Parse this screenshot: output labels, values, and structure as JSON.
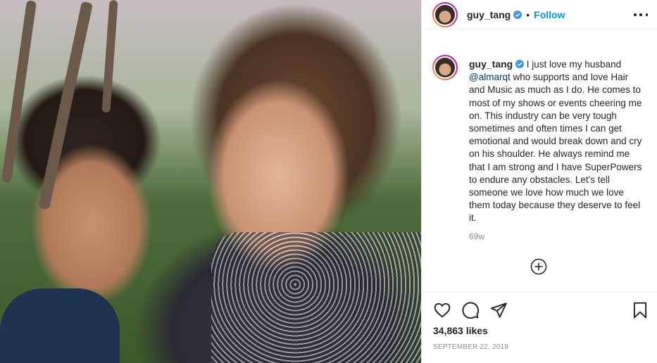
{
  "post": {
    "username": "guy_tang",
    "follow_label": "Follow",
    "separator": "•",
    "caption_mention": "@almarqt",
    "caption_before": "I just love my husband",
    "caption_after": "who supports and love Hair and Music as much as I do. He comes to most of my shows or events cheering me on. This industry can be very tough sometimes and often times I can get emotional and would break down and cry on his shoulder. He always remind me that I am strong and I have SuperPowers to endure any obstacles. Let's tell someone we love how much we love them today because they deserve to feel it.",
    "time_ago": "69w",
    "likes": "34,863 likes",
    "date": "SEPTEMBER 22, 2019"
  },
  "icons": {
    "verified": "verified-badge-icon",
    "more": "more-options-icon",
    "add_comment": "add-comment-icon",
    "like": "heart-icon",
    "comment": "comment-icon",
    "share": "share-icon",
    "save": "bookmark-icon"
  },
  "colors": {
    "link_blue": "#0095f6",
    "mention": "#00376b",
    "muted": "#8e8e8e",
    "text": "#262626",
    "verified": "#3897f0"
  }
}
